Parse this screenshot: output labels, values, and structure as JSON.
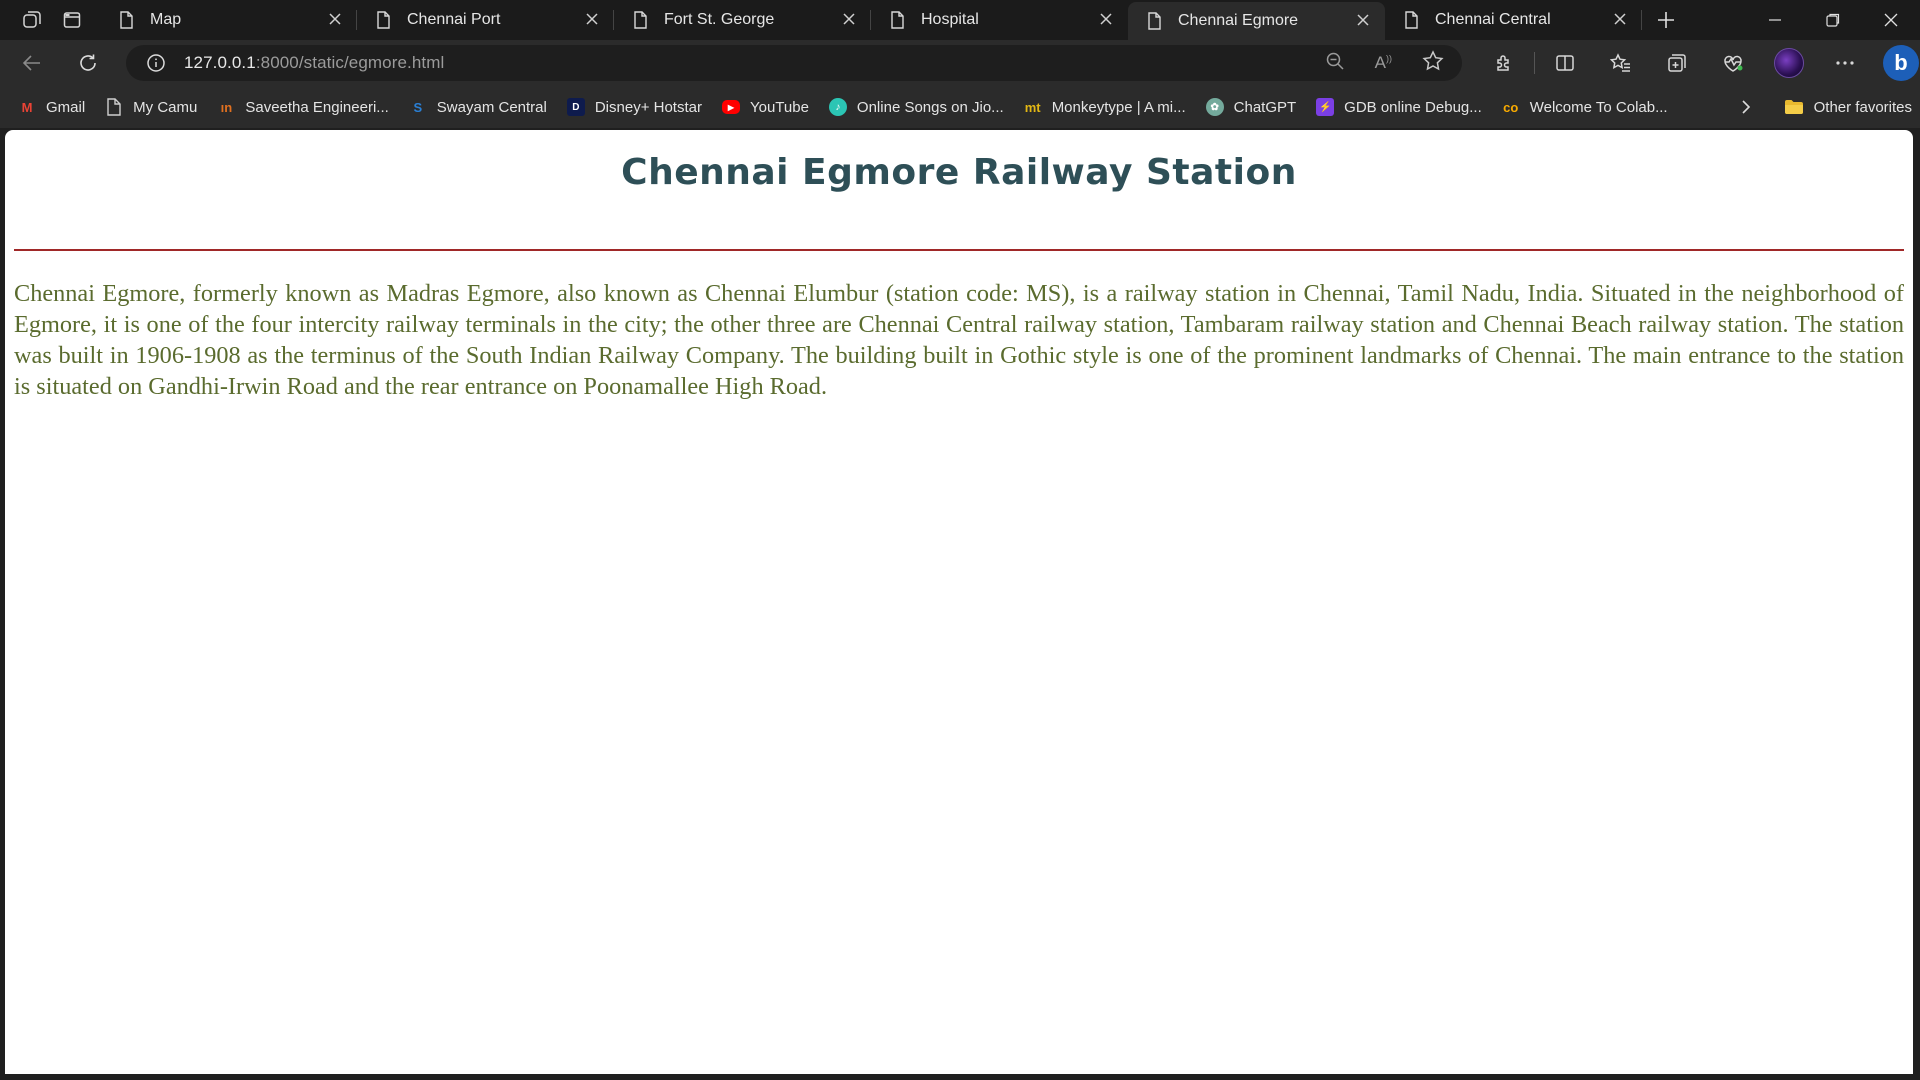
{
  "browser": {
    "tabs": [
      {
        "title": "Map",
        "active": false
      },
      {
        "title": "Chennai Port",
        "active": false
      },
      {
        "title": "Fort St. George",
        "active": false
      },
      {
        "title": "Hospital",
        "active": false
      },
      {
        "title": "Chennai Egmore",
        "active": true
      },
      {
        "title": "Chennai Central",
        "active": false
      }
    ],
    "url": {
      "host": "127.0.0.1",
      "path": ":8000/static/egmore.html"
    },
    "bookmarks": [
      {
        "label": "Gmail",
        "icon": "gmail-icon",
        "color": "#ea4335"
      },
      {
        "label": "My Camu",
        "icon": "page-icon",
        "color": "#cfcfcf"
      },
      {
        "label": "Saveetha Engineeri...",
        "icon": "saveetha-icon",
        "color": "#e07020"
      },
      {
        "label": "Swayam Central",
        "icon": "swayam-icon",
        "color": "#2a7fd4"
      },
      {
        "label": "Disney+ Hotstar",
        "icon": "hotstar-icon",
        "color": "#0e1b4d"
      },
      {
        "label": "YouTube",
        "icon": "youtube-icon",
        "color": "#ff0000"
      },
      {
        "label": "Online Songs on Jio...",
        "icon": "jiosaavn-icon",
        "color": "#2bc5b4"
      },
      {
        "label": "Monkeytype | A mi...",
        "icon": "monkeytype-icon",
        "color": "#e2b714"
      },
      {
        "label": "ChatGPT",
        "icon": "chatgpt-icon",
        "color": "#74aa9c"
      },
      {
        "label": "GDB online Debug...",
        "icon": "gdb-icon",
        "color": "#7b3fe4"
      },
      {
        "label": "Welcome To Colab...",
        "icon": "colab-icon",
        "color": "#f9ab00"
      }
    ],
    "other_favorites": "Other favorites"
  },
  "page": {
    "title": "Chennai Egmore Railway Station",
    "paragraph": "Chennai Egmore, formerly known as Madras Egmore, also known as Chennai Elumbur (station code: MS), is a railway station in Chennai, Tamil Nadu, India. Situated in the neighborhood of Egmore, it is one of the four intercity railway terminals in the city; the other three are Chennai Central railway station, Tambaram railway station and Chennai Beach railway station. The station was built in 1906-1908 as the terminus of the South Indian Railway Company. The building built in Gothic style is one of the prominent landmarks of Chennai. The main entrance to the station is situated on Gandhi-Irwin Road and the rear entrance on Poonamallee High Road."
  }
}
